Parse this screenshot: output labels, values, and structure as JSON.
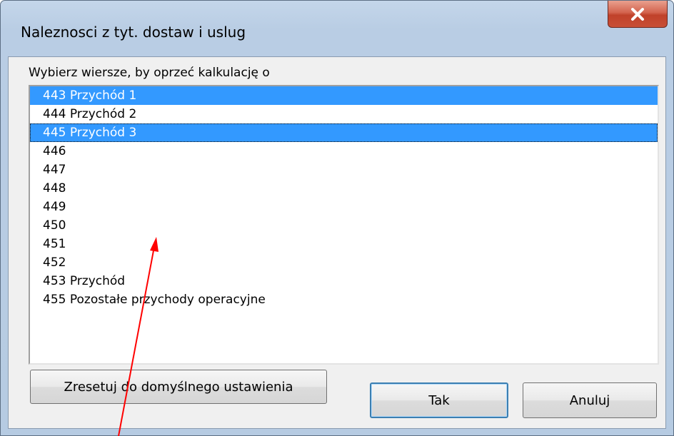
{
  "window": {
    "title": "Naleznosci z tyt. dostaw i uslug",
    "close_glyph": "X"
  },
  "dialog": {
    "prompt": "Wybierz wiersze, by oprzeć kalkulację o",
    "list_items": [
      {
        "label": "443 Przychód 1",
        "selected": true
      },
      {
        "label": "444 Przychód 2",
        "selected": false
      },
      {
        "label": "445 Przychód 3",
        "selected": true,
        "focused": true
      },
      {
        "label": "446",
        "selected": false
      },
      {
        "label": "447",
        "selected": false
      },
      {
        "label": "448",
        "selected": false
      },
      {
        "label": "449",
        "selected": false
      },
      {
        "label": "450",
        "selected": false
      },
      {
        "label": "451",
        "selected": false
      },
      {
        "label": "452",
        "selected": false
      },
      {
        "label": "453 Przychód",
        "selected": false
      },
      {
        "label": "455 Pozostałe przychody operacyjne",
        "selected": false
      }
    ],
    "buttons": {
      "reset_label": "Zresetuj do domyślnego ustawienia",
      "ok_label": "Tak",
      "cancel_label": "Anuluj"
    }
  },
  "annotation": {
    "arrow_color": "#ff0000",
    "icon": "red-arrow-icon"
  },
  "colors": {
    "selection": "#3399ff",
    "close_button": "#c84f36"
  }
}
